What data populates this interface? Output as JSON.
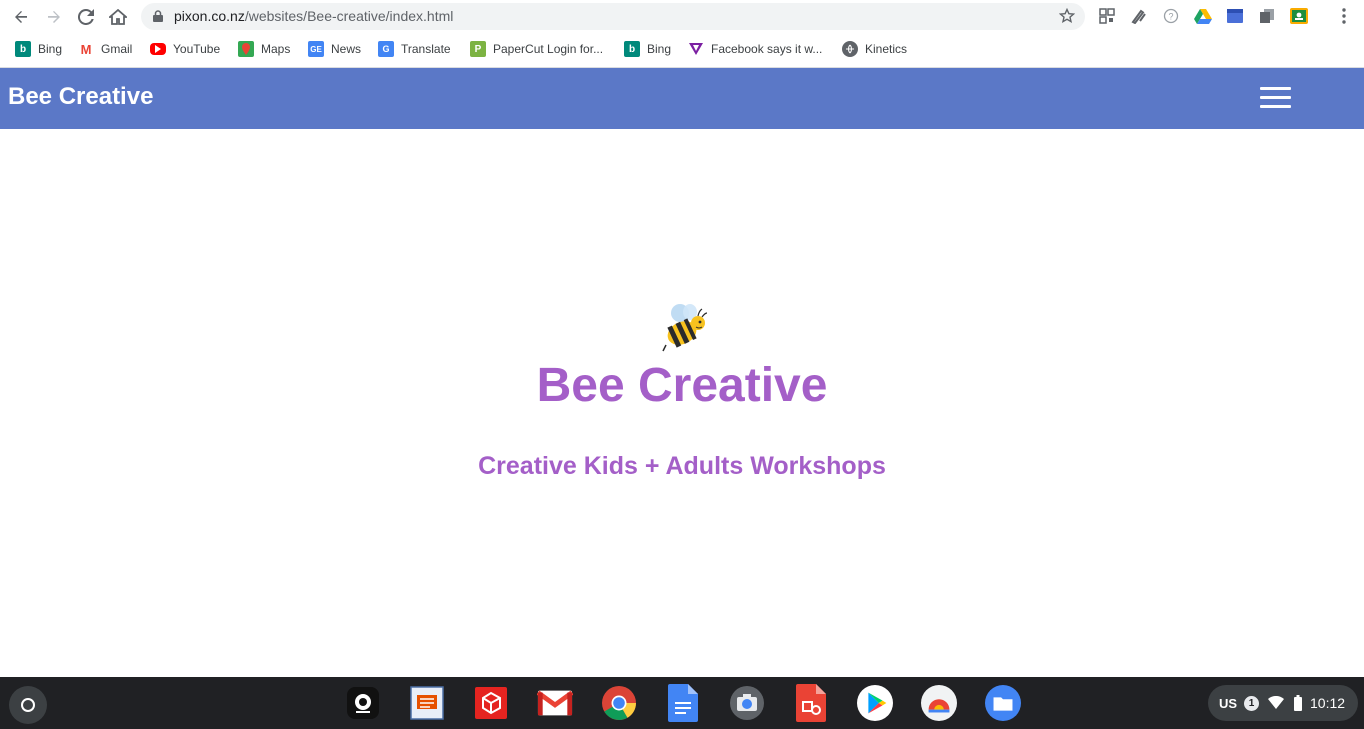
{
  "browser": {
    "url_host": "pixon.co.nz",
    "url_path": "/websites/Bee-creative/index.html"
  },
  "bookmarks": [
    {
      "label": "Bing",
      "icon": "bing-icon"
    },
    {
      "label": "Gmail",
      "icon": "gmail-icon"
    },
    {
      "label": "YouTube",
      "icon": "youtube-icon"
    },
    {
      "label": "Maps",
      "icon": "maps-icon"
    },
    {
      "label": "News",
      "icon": "news-icon"
    },
    {
      "label": "Translate",
      "icon": "translate-icon"
    },
    {
      "label": "PaperCut Login for...",
      "icon": "papercut-icon"
    },
    {
      "label": "Bing",
      "icon": "bing-icon"
    },
    {
      "label": "Facebook says it w...",
      "icon": "vice-icon"
    },
    {
      "label": "Kinetics",
      "icon": "globe-icon"
    }
  ],
  "site": {
    "brand": "Bee Creative",
    "hero_title": "Bee Creative",
    "hero_subtitle": "Creative Kids + Adults Workshops"
  },
  "shelf": {
    "apps": [
      "screencast-icon",
      "slides-app-icon",
      "sketchup-icon",
      "gmail-icon",
      "chrome-icon",
      "docs-icon",
      "camera-icon",
      "office-icon",
      "play-store-icon",
      "chrome-canvas-icon",
      "files-icon"
    ],
    "lang": "US",
    "notifications": "1",
    "clock": "10:12"
  },
  "colors": {
    "header": "#5b78c7",
    "hero_text": "#a45fc8"
  }
}
